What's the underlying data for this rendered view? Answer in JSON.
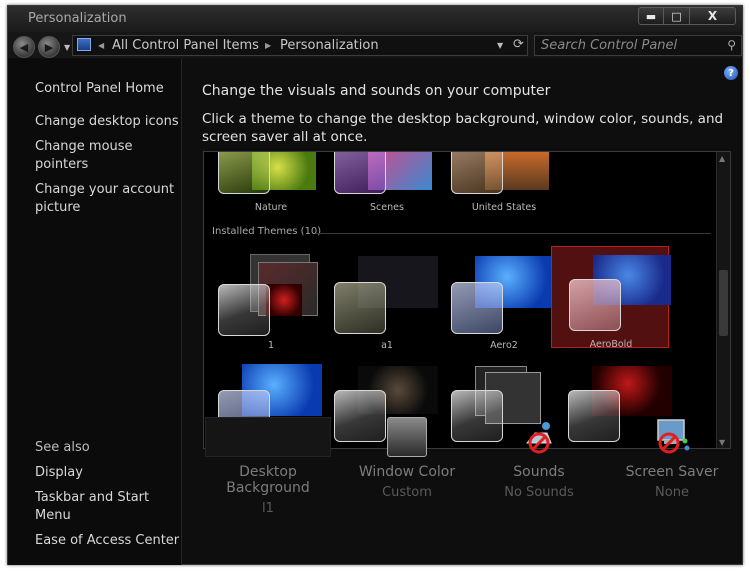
{
  "window": {
    "title": "Personalization",
    "controls": {
      "minimize": "▬",
      "maximize": "□",
      "close": "X"
    }
  },
  "nav": {
    "breadcrumb": [
      "All Control Panel Items",
      "Personalization"
    ],
    "search_placeholder": "Search Control Panel"
  },
  "sidebar": {
    "links": [
      "Control Panel Home",
      "Change desktop icons",
      "Change mouse pointers",
      "Change your account picture"
    ],
    "see_also_title": "See also",
    "see_also": [
      "Display",
      "Taskbar and Start Menu",
      "Ease of Access Center"
    ]
  },
  "main": {
    "heading": "Change the visuals and sounds on your computer",
    "subheading": "Click a theme to change the desktop background, window color, sounds, and screen saver all at once.",
    "help": "?",
    "installed_label": "Installed Themes (10)",
    "aero_themes": [
      {
        "name": "Nature",
        "color": "#6a9a1e"
      },
      {
        "name": "Scenes",
        "color": "#7a3aa8"
      },
      {
        "name": "United States",
        "color": "#a8743a"
      }
    ],
    "installed_themes": [
      {
        "name": "1",
        "selected": false
      },
      {
        "name": "a1",
        "selected": false
      },
      {
        "name": "Aero2",
        "selected": false
      },
      {
        "name": "AeroBold",
        "selected": true
      }
    ]
  },
  "bottom": {
    "desktop_background": {
      "label": "Desktop Background",
      "value": "l1"
    },
    "window_color": {
      "label": "Window Color",
      "value": "Custom"
    },
    "sounds": {
      "label": "Sounds",
      "value": "No Sounds"
    },
    "screen_saver": {
      "label": "Screen Saver",
      "value": "None"
    }
  },
  "colors": {
    "accent_selected": "#b42020",
    "win7_blue": "#1f6fd8"
  }
}
